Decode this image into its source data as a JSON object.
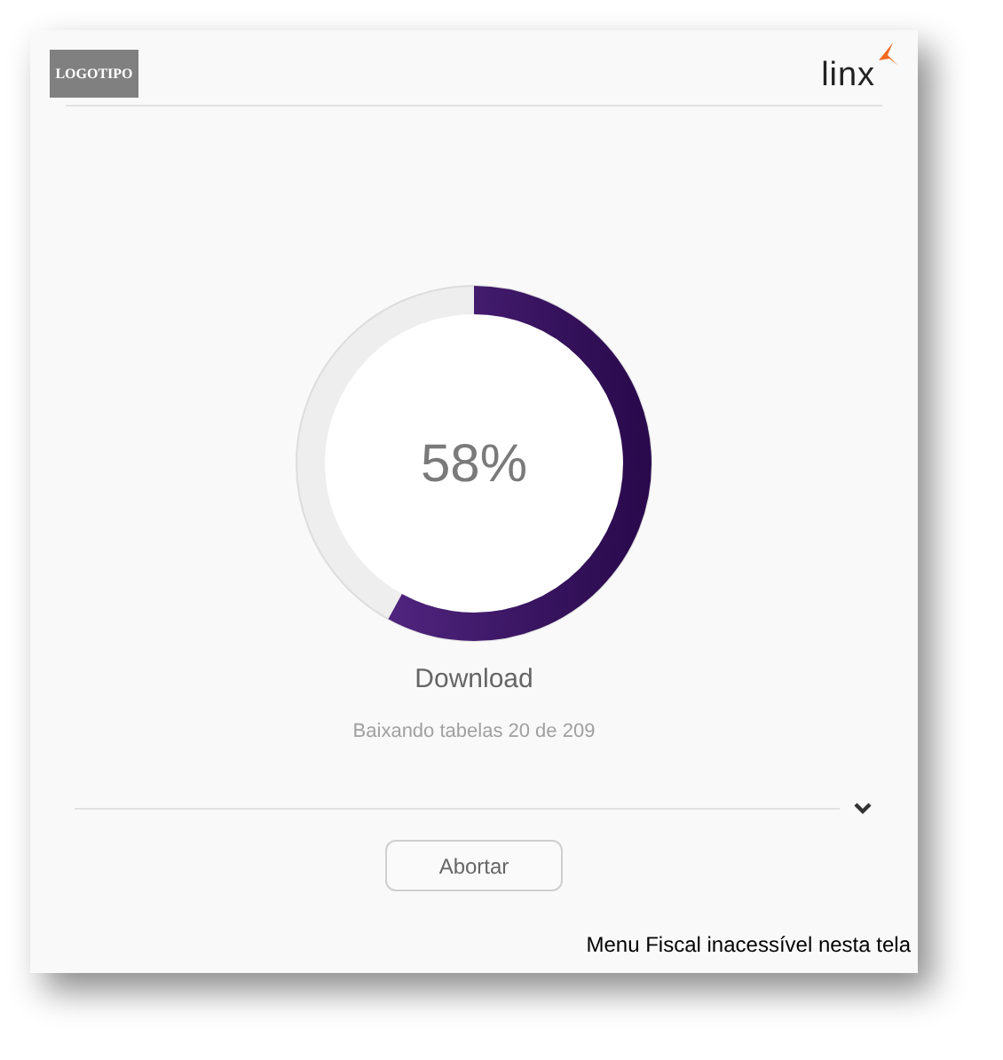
{
  "header": {
    "logo_placeholder": "LOGOTIPO",
    "brand": "linx"
  },
  "progress": {
    "level": 0.58,
    "percent": "58%"
  },
  "title": "Download",
  "status": "Baixando tabelas 20 de 209",
  "details": {
    "expanded": false
  },
  "buttons": [
    "Abortar"
  ],
  "footer": "Menu Fiscal inacessível nesta tela"
}
